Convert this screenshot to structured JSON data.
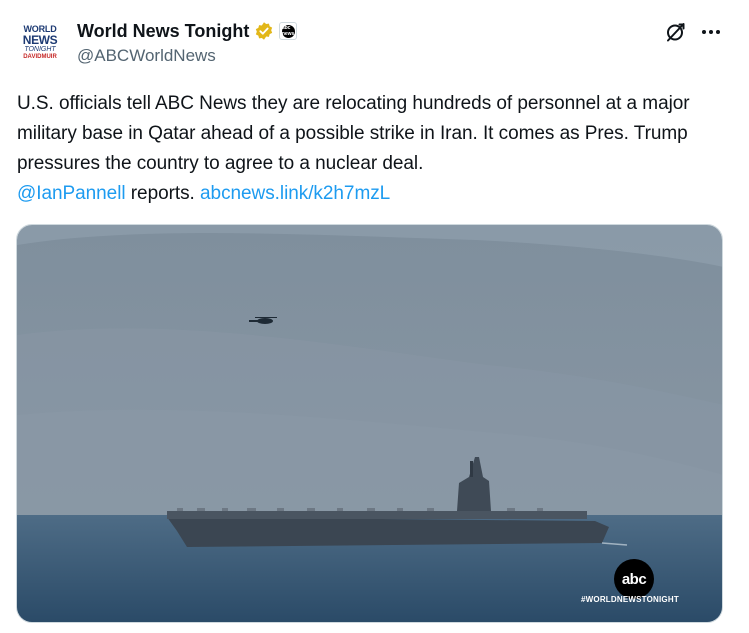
{
  "account": {
    "avatar_text": {
      "line1": "WORLD",
      "line2": "NEWS",
      "line3": "TONIGHT",
      "line4": "DAVIDMUIR"
    },
    "display_name": "World News Tonight",
    "handle": "@ABCWorldNews",
    "verified_icon": "gold-verified-check-icon",
    "affiliate_badge_icon": "abc-news-affiliate-icon",
    "affiliate_badge_text": "abc news"
  },
  "actions": {
    "grok_icon": "grok-slash-circle-icon",
    "more_icon": "more-horizontal-icon"
  },
  "post": {
    "text_main": "U.S. officials tell ABC News they are relocating hundreds of personnel at a major military base in Qatar ahead of a possible strike in Iran. It comes as Pres. Trump pressures the country to agree to a nuclear deal.",
    "mention": "@IanPannell",
    "text_after_mention": " reports. ",
    "link": "abcnews.link/k2h7mzL"
  },
  "media": {
    "watermark_logo": "abc",
    "watermark_hashtag": "#WORLDNEWSTONIGHT"
  },
  "colors": {
    "link": "#1d9bf0",
    "text": "#0f1419",
    "secondary": "#536471",
    "verified_gold": "#e2b719"
  }
}
